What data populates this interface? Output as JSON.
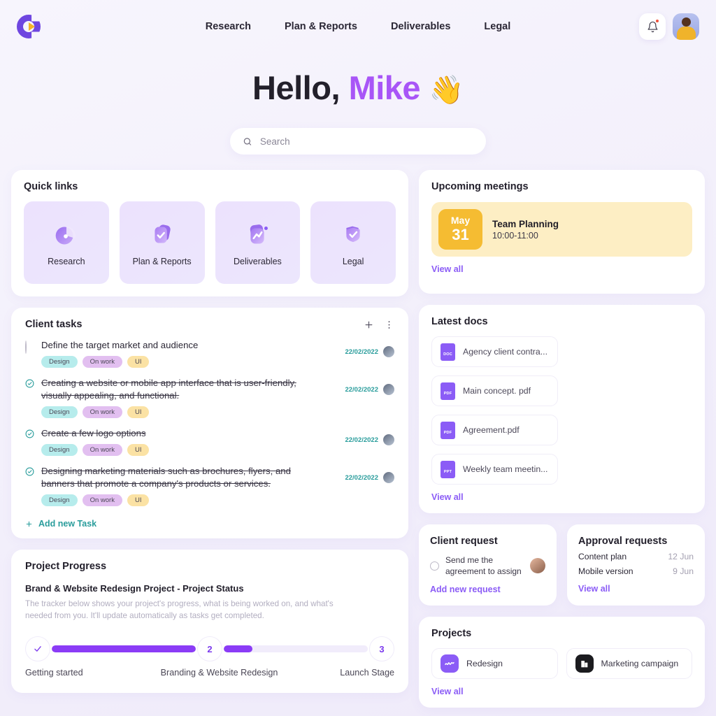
{
  "header": {
    "logo_name": "brand-logo",
    "nav": [
      {
        "label": "Research"
      },
      {
        "label": "Plan & Reports"
      },
      {
        "label": "Deliverables"
      },
      {
        "label": "Legal"
      }
    ],
    "bell_icon": "bell-icon",
    "avatar_alt": "user-avatar"
  },
  "greeting": {
    "hello": "Hello,",
    "name": "Mike",
    "wave": "👋"
  },
  "search": {
    "placeholder": "Search",
    "value": "",
    "icon": "search-icon"
  },
  "quick_links": {
    "title": "Quick links",
    "items": [
      {
        "label": "Research",
        "icon": "pie-chart-icon"
      },
      {
        "label": "Plan & Reports",
        "icon": "check-shield-icon"
      },
      {
        "label": "Deliverables",
        "icon": "chart-line-icon"
      },
      {
        "label": "Legal",
        "icon": "shield-check-icon"
      }
    ]
  },
  "upcoming_meetings": {
    "title": "Upcoming meetings",
    "meeting": {
      "month": "May",
      "day": "31",
      "name": "Team Planning",
      "time": "10:00-11:00"
    },
    "view_all": "View all"
  },
  "client_tasks": {
    "title": "Client tasks",
    "add_icon": "plus-icon",
    "more_icon": "more-vertical-icon",
    "add_new": "Add new Task",
    "items": [
      {
        "text": "Define the target market and audience",
        "done": false,
        "date": "22/02/2022",
        "tags": [
          "Design",
          "On work",
          "UI"
        ]
      },
      {
        "text": "Creating a website or mobile app interface that is user-friendly, visually appealing, and functional.",
        "done": true,
        "date": "22/02/2022",
        "tags": [
          "Design",
          "On work",
          "UI"
        ]
      },
      {
        "text": "Create a few logo options",
        "done": true,
        "date": "22/02/2022",
        "tags": [
          "Design",
          "On work",
          "UI"
        ]
      },
      {
        "text": "Designing marketing materials such as brochures, flyers, and banners that promote a company's products or services.",
        "done": true,
        "date": "22/02/2022",
        "tags": [
          "Design",
          "On work",
          "UI"
        ]
      }
    ]
  },
  "latest_docs": {
    "title": "Latest docs",
    "view_all": "View all",
    "items": [
      {
        "name": "Agency client contra...",
        "type": "DOC"
      },
      {
        "name": "Main concept. pdf",
        "type": "PDF"
      },
      {
        "name": "Agreement.pdf",
        "type": "PDF"
      },
      {
        "name": "Weekly team meetin...",
        "type": "PPT"
      }
    ]
  },
  "client_request": {
    "title": "Client request",
    "request_text": "Send me the agreement to assign",
    "add_new": "Add new request"
  },
  "approval_requests": {
    "title": "Approval requests",
    "items": [
      {
        "name": "Content plan",
        "date": "12 Jun"
      },
      {
        "name": "Mobile version",
        "date": "9 Jun"
      }
    ],
    "view_all": "View all"
  },
  "project_progress": {
    "title": "Project Progress",
    "subtitle": "Brand & Website Redesign Project - Project Status",
    "description": "The tracker below shows your project's progress, what is being worked on, and what's needed from you. It'll update automatically as tasks get completed.",
    "steps": [
      {
        "marker": "✓",
        "label": "Getting started",
        "fill": 100
      },
      {
        "marker": "2",
        "label": "Branding & Website Redesign",
        "fill": 20
      },
      {
        "marker": "3",
        "label": "Launch Stage",
        "fill": 0
      }
    ]
  },
  "projects": {
    "title": "Projects",
    "view_all": "View all",
    "items": [
      {
        "name": "Redesign",
        "icon": "wave-icon"
      },
      {
        "name": "Marketing campaign",
        "icon": "building-icon"
      }
    ]
  },
  "colors": {
    "accent": "#8b5cf6",
    "accent_strong": "#6f46e0",
    "yellow": "#f5bc32",
    "teal": "#2a9d9c",
    "bg": "#f3f0fb"
  }
}
